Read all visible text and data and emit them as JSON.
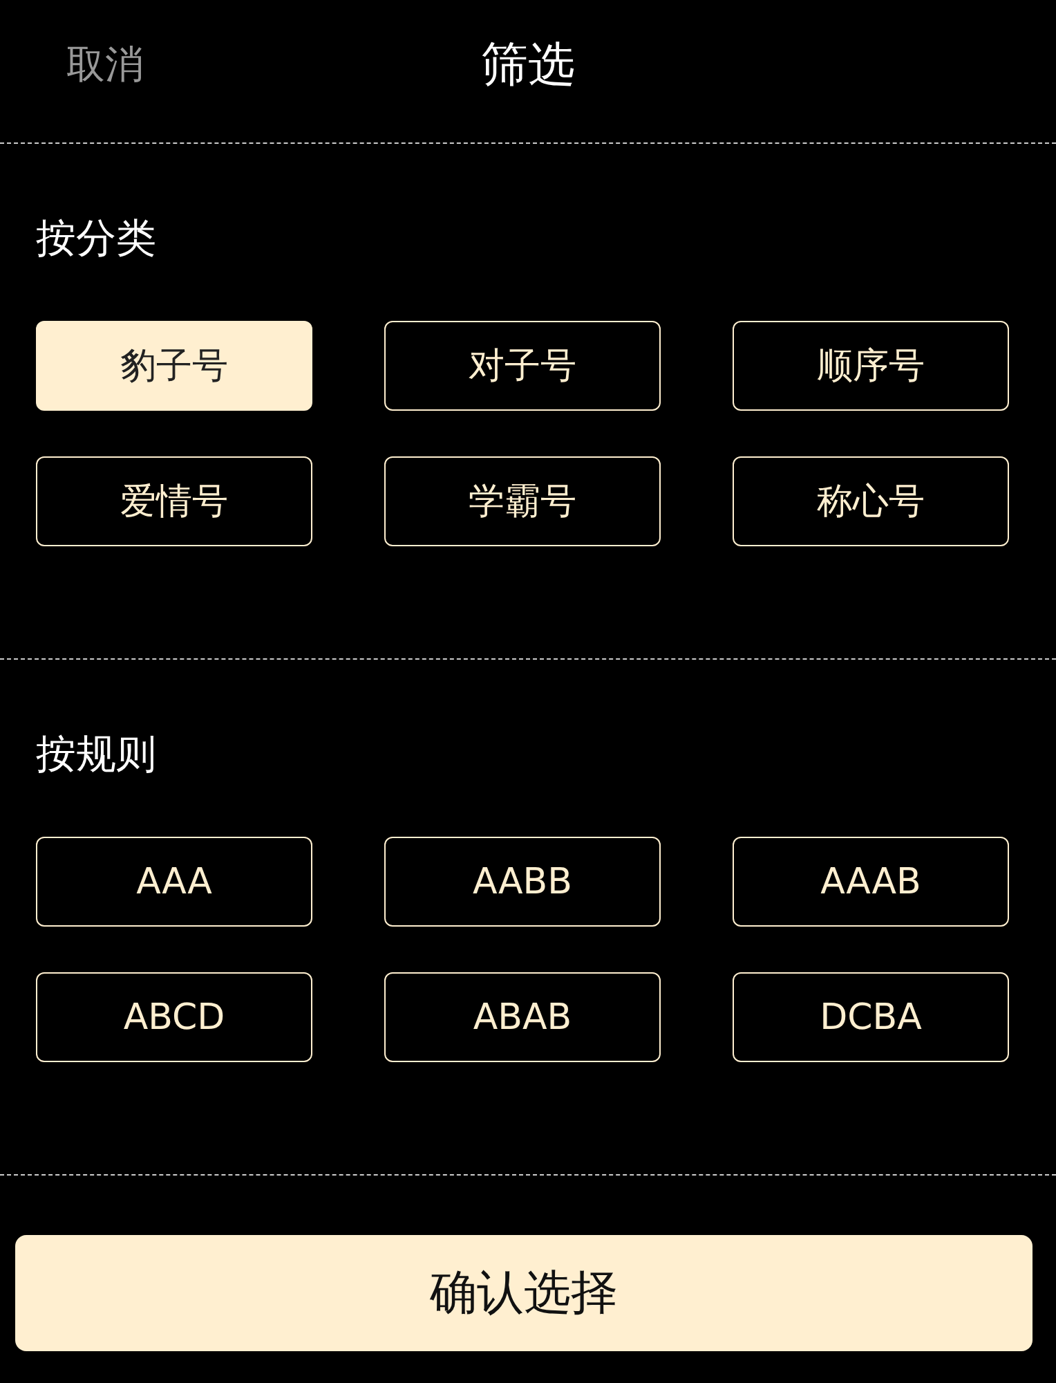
{
  "header": {
    "cancel": "取消",
    "title": "筛选"
  },
  "sections": [
    {
      "title": "按分类",
      "options": [
        {
          "label": "豹子号",
          "selected": true
        },
        {
          "label": "对子号",
          "selected": false
        },
        {
          "label": "顺序号",
          "selected": false
        },
        {
          "label": "爱情号",
          "selected": false
        },
        {
          "label": "学霸号",
          "selected": false
        },
        {
          "label": "称心号",
          "selected": false
        }
      ]
    },
    {
      "title": "按规则",
      "options": [
        {
          "label": "AAA",
          "selected": false
        },
        {
          "label": "AABB",
          "selected": false
        },
        {
          "label": "AAAB",
          "selected": false
        },
        {
          "label": "ABCD",
          "selected": false
        },
        {
          "label": "ABAB",
          "selected": false
        },
        {
          "label": "DCBA",
          "selected": false
        }
      ]
    }
  ],
  "confirm": "确认选择"
}
